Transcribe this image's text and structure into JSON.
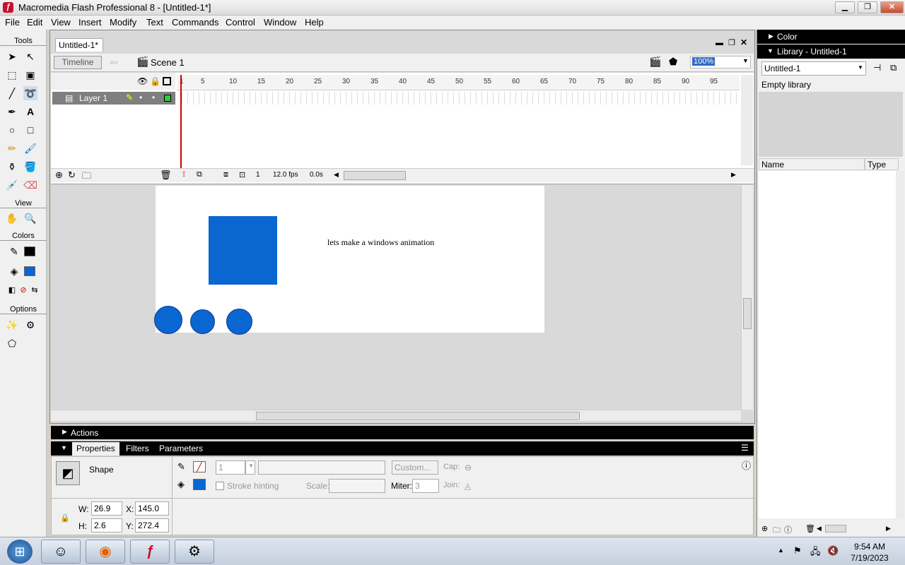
{
  "window": {
    "title": "Macromedia Flash Professional 8 - [Untitled-1*]",
    "logo": "flash-logo",
    "minimize": "▁",
    "restore": "❐",
    "close": "✕"
  },
  "menu": [
    "File",
    "Edit",
    "View",
    "Insert",
    "Modify",
    "Text",
    "Commands",
    "Control",
    "Window",
    "Help"
  ],
  "tools": {
    "title": "Tools",
    "view": "View",
    "colors": "Colors",
    "options": "Options"
  },
  "document": {
    "tab": "Untitled-1*",
    "timeline_button": "Timeline",
    "scene": "Scene 1",
    "zoom": "100%",
    "layer": "Layer 1",
    "ruler_ticks": [
      "1",
      "5",
      "10",
      "15",
      "20",
      "25",
      "30",
      "35",
      "40",
      "45",
      "50",
      "55",
      "60",
      "65",
      "70",
      "75",
      "80",
      "85",
      "90",
      "95"
    ],
    "current_frame": "1",
    "fps": "12.0 fps",
    "elapsed": "0.0s",
    "stage_text": "lets make a windows animation",
    "stage_colors": {
      "shape_fill": "#0a66d1",
      "circle_stroke": "#0d3a8a"
    }
  },
  "panels": {
    "actions": "Actions",
    "tabs": [
      "Properties",
      "Filters",
      "Parameters"
    ],
    "shape_label": "Shape",
    "stroke_height": "1",
    "custom_button": "Custom...",
    "cap_label": "Cap:",
    "stroke_hinting": "Stroke hinting",
    "scale_label": "Scale:",
    "miter_label": "Miter:",
    "miter_value": "3",
    "join_label": "Join:",
    "w_label": "W:",
    "w_value": "26.9",
    "x_label": "X:",
    "x_value": "145.0",
    "h_label": "H:",
    "h_value": "2.6",
    "y_label": "Y:",
    "y_value": "272.4"
  },
  "right": {
    "color_panel": "Color",
    "library_panel": "Library - Untitled-1",
    "library_select": "Untitled-1",
    "empty": "Empty library",
    "col_name": "Name",
    "col_type": "Type"
  },
  "taskbar": {
    "time": "9:54 AM",
    "date": "7/19/2023"
  }
}
